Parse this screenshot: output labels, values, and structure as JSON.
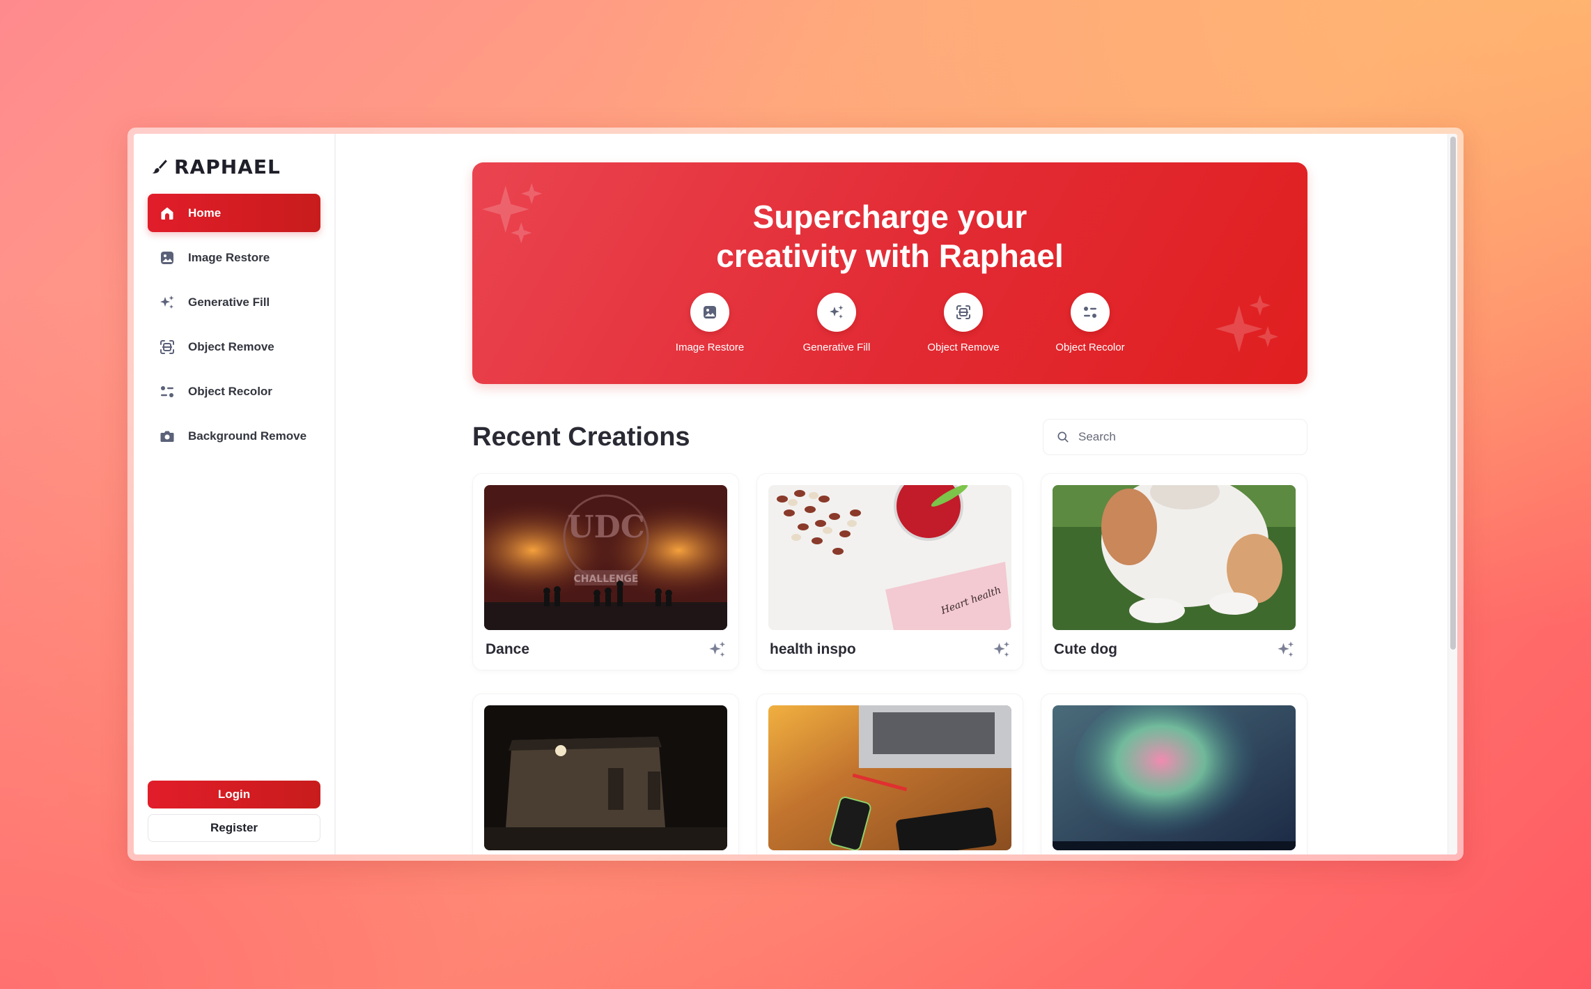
{
  "brand": {
    "name": "RAPHAEL",
    "accent": "#e11d2a",
    "icon": "paintbrush-icon"
  },
  "sidebar": {
    "items": [
      {
        "label": "Home",
        "icon": "home-icon",
        "active": true
      },
      {
        "label": "Image Restore",
        "icon": "image-icon",
        "active": false
      },
      {
        "label": "Generative Fill",
        "icon": "sparkles-icon",
        "active": false
      },
      {
        "label": "Object Remove",
        "icon": "scan-icon",
        "active": false
      },
      {
        "label": "Object Recolor",
        "icon": "sliders-icon",
        "active": false
      },
      {
        "label": "Background Remove",
        "icon": "camera-icon",
        "active": false
      }
    ],
    "login_label": "Login",
    "register_label": "Register"
  },
  "hero": {
    "title_line1": "Supercharge your",
    "title_line2_prefix": "creativity with ",
    "title_line2_brand": "Raphael",
    "features": [
      {
        "label": "Image Restore",
        "icon": "image-icon"
      },
      {
        "label": "Generative Fill",
        "icon": "sparkles-icon"
      },
      {
        "label": "Object Remove",
        "icon": "scan-icon"
      },
      {
        "label": "Object Recolor",
        "icon": "sliders-icon"
      }
    ]
  },
  "recent": {
    "title": "Recent Creations",
    "search_placeholder": "Search",
    "cards": [
      {
        "title": "Dance",
        "image": "dance-stage-photo"
      },
      {
        "title": "health inspo",
        "image": "nuts-and-drink-photo"
      },
      {
        "title": "Cute dog",
        "image": "dog-on-grass-photo"
      },
      {
        "title": "",
        "image": "night-building-photo"
      },
      {
        "title": "",
        "image": "laptop-desk-photo"
      },
      {
        "title": "",
        "image": "aurora-sky-photo"
      }
    ]
  }
}
